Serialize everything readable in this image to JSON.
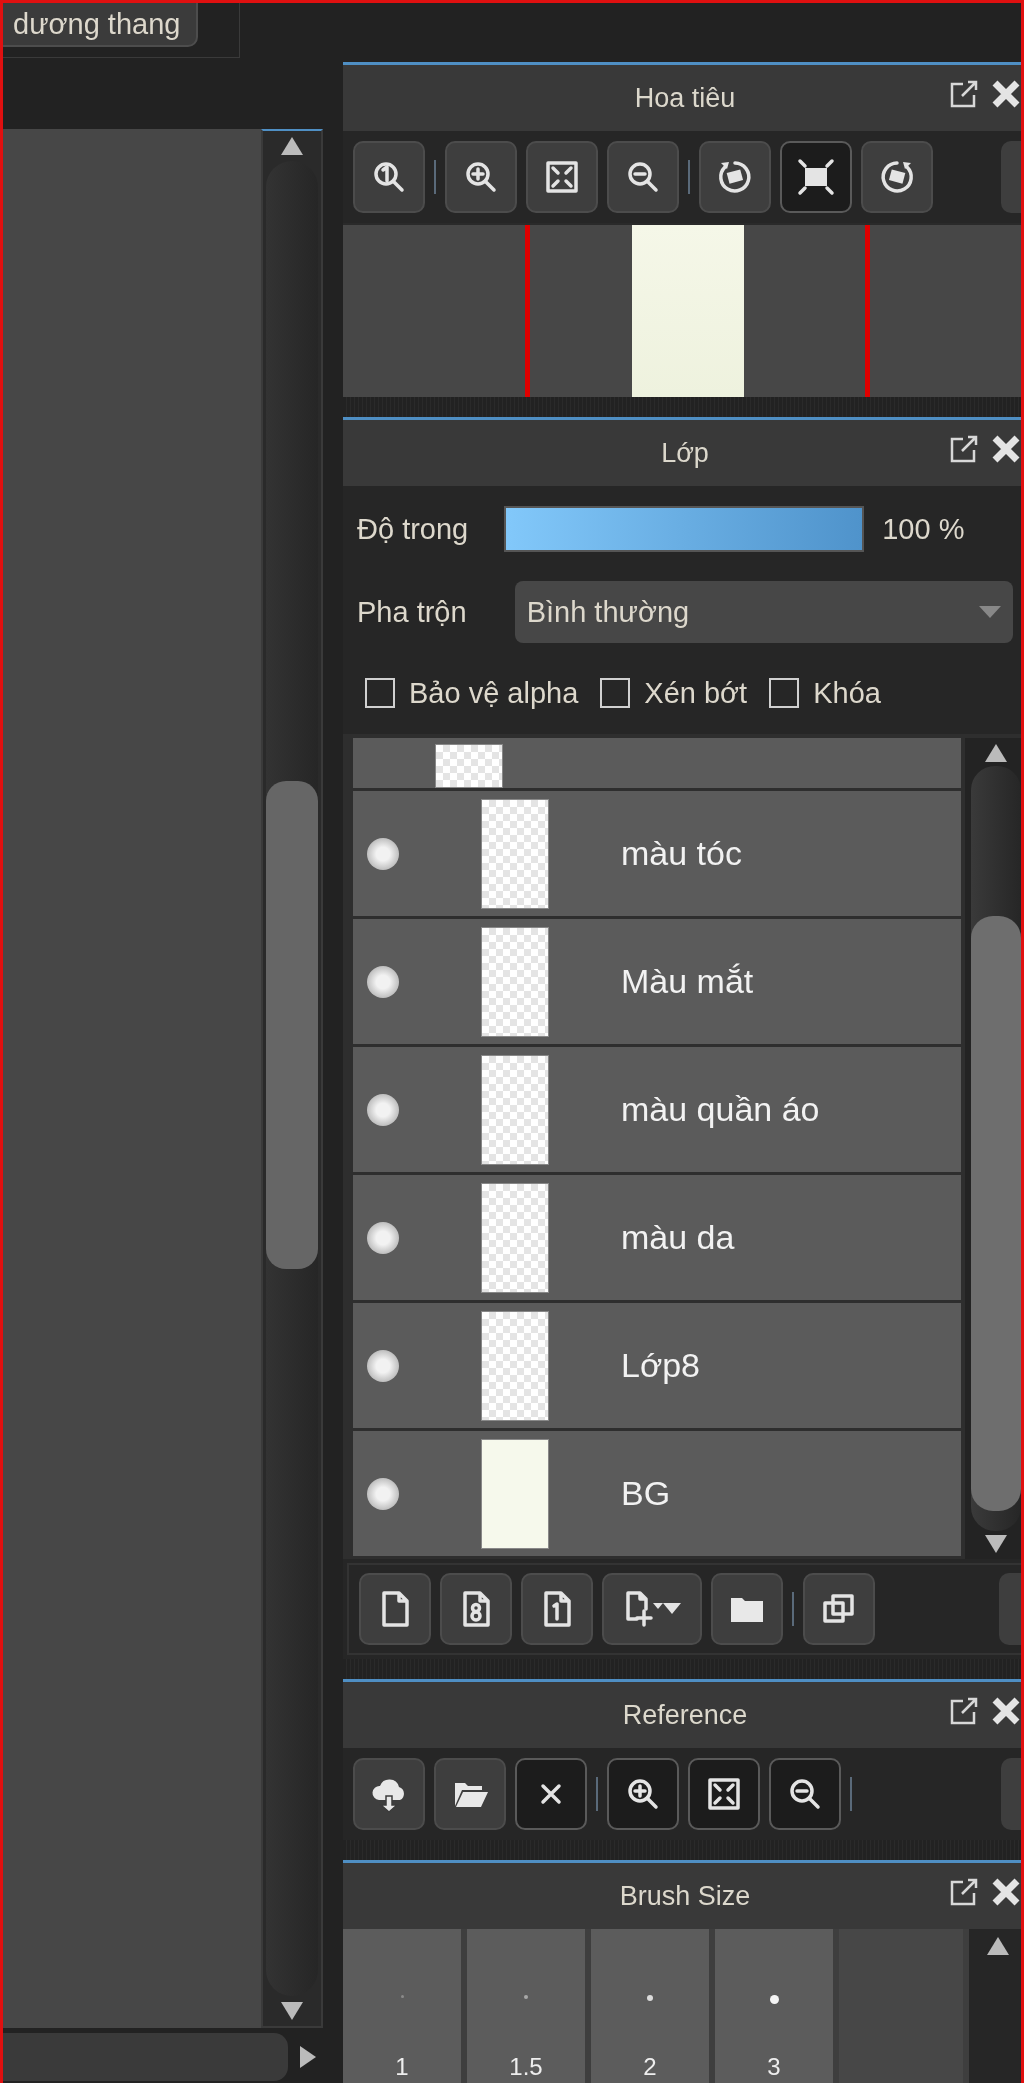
{
  "canvas": {
    "button": "dương thang"
  },
  "navigator": {
    "title": "Hoa tiêu",
    "tools": [
      {
        "selected": false
      },
      {
        "selected": false
      },
      {
        "selected": false
      },
      {
        "selected": false
      },
      {
        "selected": false
      },
      {
        "selected": true
      },
      {
        "selected": false
      }
    ]
  },
  "layers_panel": {
    "title": "Lớp",
    "opacity": {
      "label": "Độ trong",
      "level": 1,
      "reading": "100 %"
    },
    "blend": {
      "label": "Pha trộn",
      "value": "Bình thường"
    },
    "options": [
      {
        "label": "Bảo vệ alpha",
        "checked": false
      },
      {
        "label": "Xén bớt",
        "checked": false
      },
      {
        "label": "Khóa",
        "checked": false
      }
    ],
    "layers": [
      {
        "name": "màu tóc",
        "kind": "transparent"
      },
      {
        "name": "Màu mắt",
        "kind": "transparent"
      },
      {
        "name": "màu quần áo",
        "kind": "transparent"
      },
      {
        "name": "màu da",
        "kind": "transparent"
      },
      {
        "name": "Lớp8",
        "kind": "transparent"
      },
      {
        "name": "BG",
        "kind": "solid"
      }
    ]
  },
  "reference": {
    "title": "Reference",
    "tools": [
      {
        "disabled": false
      },
      {
        "disabled": false
      },
      {
        "disabled": true
      },
      {
        "disabled": true
      },
      {
        "disabled": true
      },
      {
        "disabled": true
      }
    ]
  },
  "brush_size": {
    "title": "Brush Size",
    "sizes": [
      "1",
      "1.5",
      "2",
      "3"
    ]
  }
}
